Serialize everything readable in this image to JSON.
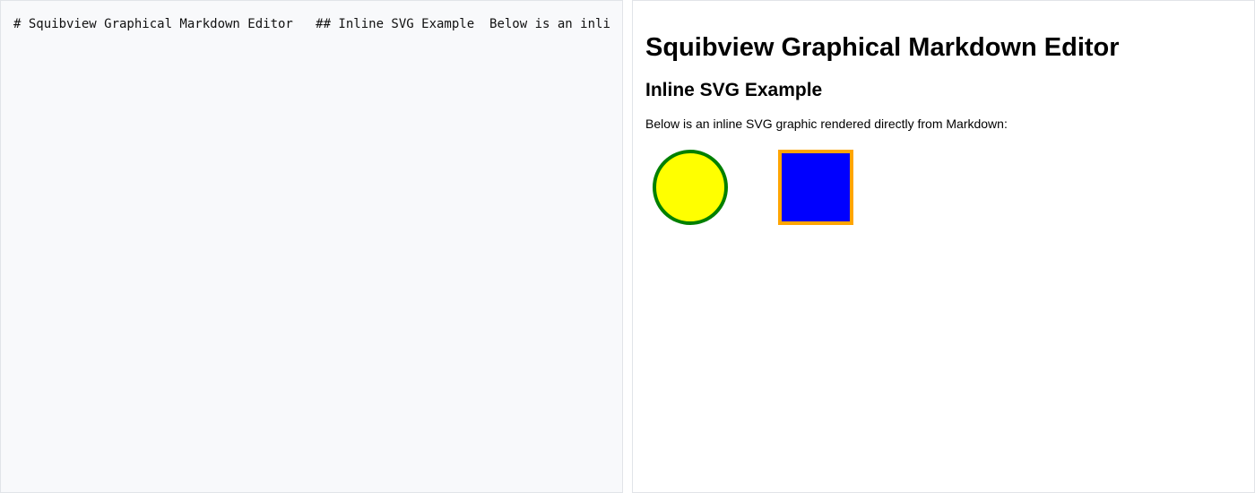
{
  "editor": {
    "content": "# Squibview Graphical Markdown Editor   ## Inline SVG Example  Below is an inline SVG graphic rendered directly from Markdown:"
  },
  "preview": {
    "heading1": "Squibview Graphical Markdown Editor",
    "heading2": "Inline SVG Example",
    "paragraph": "Below is an inline SVG graphic rendered directly from Markdown:",
    "svg": {
      "circle": {
        "fill": "#ffff00",
        "stroke": "#008000"
      },
      "square": {
        "fill": "#0000ff",
        "stroke": "#ffa500"
      }
    }
  }
}
